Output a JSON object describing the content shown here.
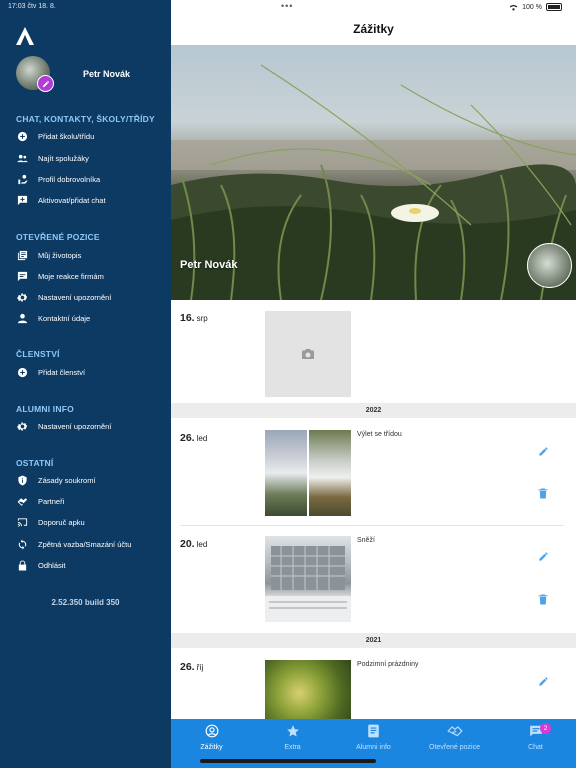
{
  "status_bar": {
    "time": "17:03 čtv 18. 8.",
    "battery": "100 %"
  },
  "sidebar": {
    "user_name": "Petr Novák",
    "sections": [
      {
        "title": "CHAT, KONTAKTY, ŠKOLY/TŘÍDY",
        "items": [
          {
            "label": "Přidat školu/třídu",
            "icon": "add-circle-icon"
          },
          {
            "label": "Najít spolužáky",
            "icon": "people-icon"
          },
          {
            "label": "Profil dobrovolníka",
            "icon": "volunteer-icon"
          },
          {
            "label": "Aktivovat/přidat chat",
            "icon": "add-chat-icon"
          }
        ]
      },
      {
        "title": "OTEVŘENÉ POZICE",
        "items": [
          {
            "label": "Můj životopis",
            "icon": "resume-icon"
          },
          {
            "label": "Moje reakce firmám",
            "icon": "reply-icon"
          },
          {
            "label": "Nastavení upozornění",
            "icon": "gear-icon"
          },
          {
            "label": "Kontaktní údaje",
            "icon": "person-icon"
          }
        ]
      },
      {
        "title": "ČLENSTVÍ",
        "items": [
          {
            "label": "Přidat členství",
            "icon": "add-circle-icon"
          }
        ]
      },
      {
        "title": "ALUMNI INFO",
        "items": [
          {
            "label": "Nastavení upozornění",
            "icon": "gear-icon"
          }
        ]
      },
      {
        "title": "OSTATNÍ",
        "items": [
          {
            "label": "Zásady soukromí",
            "icon": "shield-icon"
          },
          {
            "label": "Partneři",
            "icon": "handshake-icon"
          },
          {
            "label": "Doporuč apku",
            "icon": "cast-icon"
          },
          {
            "label": "Zpětná vazba/Smazání účtu",
            "icon": "sync-icon"
          },
          {
            "label": "Odhlásit",
            "icon": "lock-icon"
          }
        ]
      }
    ],
    "version": "2.52.350 build 350"
  },
  "main": {
    "title": "Zážitky",
    "hero_name": "Petr Novák",
    "entries": [
      {
        "day": "16.",
        "month": "srp",
        "caption": ""
      },
      {
        "year": "2022"
      },
      {
        "day": "26.",
        "month": "led",
        "caption": "Výlet se třídou"
      },
      {
        "day": "20.",
        "month": "led",
        "caption": "Sněží"
      },
      {
        "year": "2021"
      },
      {
        "day": "26.",
        "month": "říj",
        "caption": "Podzimní prázdniny"
      }
    ]
  },
  "tabs": [
    {
      "label": "Zážitky",
      "icon": "profile-circle-icon",
      "active": true
    },
    {
      "label": "Extra",
      "icon": "star-icon",
      "active": false
    },
    {
      "label": "Alumni info",
      "icon": "document-icon",
      "active": false
    },
    {
      "label": "Otevřené pozice",
      "icon": "handshake-icon",
      "active": false
    },
    {
      "label": "Chat",
      "icon": "chat-icon",
      "active": false,
      "badge": "2"
    }
  ],
  "colors": {
    "sidebar_bg": "#0d3a63",
    "section_title": "#8ec8f7",
    "tabbar_bg": "#1b86e0",
    "edit_badge": "#b23bd6",
    "action_icon": "#4da3ea"
  }
}
